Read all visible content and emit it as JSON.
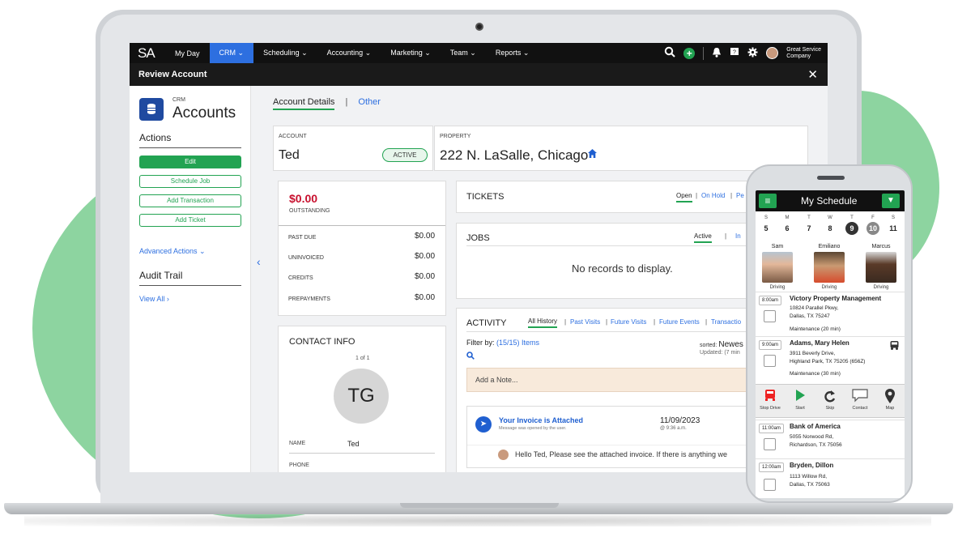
{
  "nav": {
    "logo": "SA",
    "items": [
      "My Day",
      "CRM ⌄",
      "Scheduling ⌄",
      "Accounting ⌄",
      "Marketing ⌄",
      "Team ⌄",
      "Reports ⌄"
    ],
    "company_line1": "Great Service",
    "company_line2": "Company"
  },
  "titlebar": {
    "title": "Review Account",
    "close": "✕"
  },
  "sidebar": {
    "crm_small": "CRM",
    "crm_big": "Accounts",
    "actions_heading": "Actions",
    "edit": "Edit",
    "schedule_job": "Schedule Job",
    "add_transaction": "Add Transaction",
    "add_ticket": "Add Ticket",
    "advanced_actions": "Advanced Actions ⌄",
    "audit_heading": "Audit Trail",
    "view_all": "View All ›"
  },
  "tabs": {
    "account_details": "Account Details",
    "separator": "|",
    "other": "Other"
  },
  "account": {
    "label": "ACCOUNT",
    "name": "Ted",
    "status": "ACTIVE"
  },
  "property": {
    "label": "PROPERTY",
    "address": "222 N. LaSalle, Chicago"
  },
  "balance": {
    "amount": "$0.00",
    "outstanding_label": "OUTSTANDING",
    "rows": [
      {
        "label": "PAST DUE",
        "value": "$0.00"
      },
      {
        "label": "UNINVOICED",
        "value": "$0.00"
      },
      {
        "label": "CREDITS",
        "value": "$0.00"
      },
      {
        "label": "PREPAYMENTS",
        "value": "$0.00"
      }
    ]
  },
  "contact": {
    "title": "CONTACT INFO",
    "pager": "1 of 1",
    "initials": "TG",
    "name_label": "NAME",
    "name_value": "Ted",
    "phone_label": "PHONE"
  },
  "tickets": {
    "title": "TICKETS",
    "tab_open": "Open",
    "sep1": "|",
    "tab_onhold": "On Hold",
    "sep2": "|",
    "tab_p": "Pe"
  },
  "jobs": {
    "title": "JOBS",
    "tab_active": "Active",
    "sep": "|",
    "tab_in": "In",
    "empty": "No records to display."
  },
  "activity": {
    "title": "ACTIVITY",
    "tabs": [
      "All History",
      "|",
      "Past Visits",
      "|",
      "Future Visits",
      "|",
      "Future Events",
      "|",
      "Transactio"
    ],
    "filter_label": "Filter by:",
    "filter_value": "(15/15) Items",
    "sorted_label": "sorted:",
    "sorted_value": "Newes",
    "updated": "Updated: (7 min",
    "note_placeholder": "Add a Note...",
    "item_title": "Your Invoice is Attached",
    "item_sub": "Message was opened by the user.",
    "item_date": "11/09/2023",
    "item_time": "@ 9:36 a.m.",
    "item_message": "Hello Ted, Please see the attached invoice. If there is anything we"
  },
  "phone": {
    "title": "My Schedule",
    "days": [
      {
        "dow": "S",
        "num": "5"
      },
      {
        "dow": "M",
        "num": "6"
      },
      {
        "dow": "T",
        "num": "7"
      },
      {
        "dow": "W",
        "num": "8"
      },
      {
        "dow": "T",
        "num": "9"
      },
      {
        "dow": "F",
        "num": "10"
      },
      {
        "dow": "S",
        "num": "11"
      }
    ],
    "techs": [
      {
        "name": "Sam",
        "status": "Driving"
      },
      {
        "name": "Emiliano",
        "status": "Driving"
      },
      {
        "name": "Marcus",
        "status": "Driving"
      }
    ],
    "appts": [
      {
        "time": "8:00am",
        "name": "Victory Property Management",
        "line1": "10824 Parallel Pkwy,",
        "line2": "Dallas, TX 75247",
        "line3": "Maintenance (20 min)"
      },
      {
        "time": "9:00am",
        "name": "Adams, Mary Helen",
        "line1": "3911 Beverly Drive,",
        "line2": "Highland Park, TX 75205 (656Z)",
        "line3": "Maintenance (30 min)"
      },
      {
        "time": "11:00am",
        "name": "Bank of America",
        "line1": "5055 Norwood Rd,",
        "line2": "Richardson, TX 75056",
        "line3": ""
      },
      {
        "time": "12:00am",
        "name": "Bryden, Dillon",
        "line1": "1113 Willow Rd,",
        "line2": "Dallas, TX 75063",
        "line3": ""
      }
    ],
    "tools": [
      "Stop Drive",
      "Start",
      "Skip",
      "Contact",
      "Map"
    ]
  },
  "colors": {
    "accent_green": "#22a352",
    "nav_blue": "#2d6fe0",
    "money_red": "#c8102e",
    "blob": "#8dd4a0"
  }
}
